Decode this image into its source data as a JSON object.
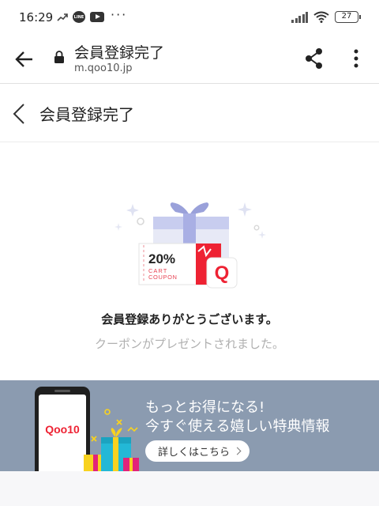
{
  "status_bar": {
    "time": "16:29",
    "line_icon_text": "LINE",
    "more": "···",
    "battery": "27"
  },
  "browser_bar": {
    "title": "会員登録完了",
    "url": "m.qoo10.jp"
  },
  "page_header": {
    "title": "会員登録完了"
  },
  "coupon": {
    "percent": "20%",
    "line1": "CART",
    "line2": "COUPON",
    "logo_letter": "Q"
  },
  "message": {
    "main": "会員登録ありがとうございます。",
    "sub": "クーポンがプレゼントされました。"
  },
  "banner": {
    "phone_logo": "Qoo10",
    "line1": "もっとお得になる!",
    "line2": "今すぐ使える嬉しい特典情報",
    "button_label": "詳しくはこちら"
  },
  "colors": {
    "banner_bg": "#8b9bb0",
    "brand_red": "#ee2233",
    "ribbon": "#aab1e6"
  }
}
